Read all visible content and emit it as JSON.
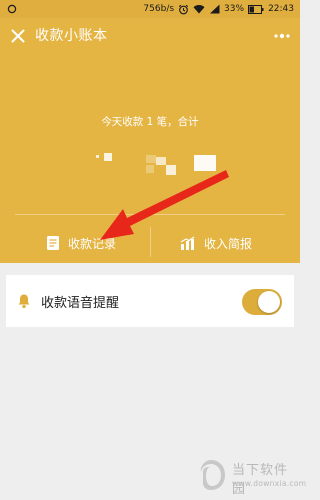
{
  "status_bar": {
    "speed": "756b/s",
    "battery": "33%",
    "time": "22:43"
  },
  "header": {
    "title": "收款小账本"
  },
  "summary": {
    "text": "今天收款 1 笔，合计"
  },
  "actions": {
    "records_label": "收款记录",
    "report_label": "收入简报"
  },
  "settings": {
    "voice_label": "收款语音提醒",
    "voice_enabled": true
  },
  "watermark": {
    "name": "当下软件园",
    "url": "www.downxia.com"
  },
  "colors": {
    "brand_yellow": "#e5b544",
    "status_yellow": "#dfae3f",
    "toggle_on": "#dcad3b",
    "arrow_red": "#e8271b"
  }
}
